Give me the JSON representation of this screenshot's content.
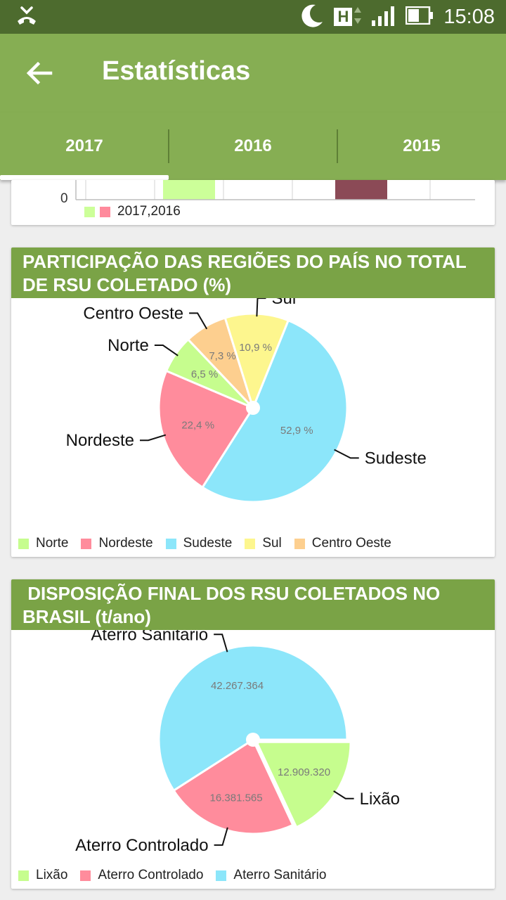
{
  "status_bar": {
    "time": "15:08",
    "network_letter": "H"
  },
  "header": {
    "title": "Estatísticas"
  },
  "tabs": [
    {
      "label": "2017"
    },
    {
      "label": "2016"
    },
    {
      "label": "2015"
    }
  ],
  "active_tab": "2017",
  "top_chart": {
    "y_tick": "0",
    "legend_label": "2017,2016",
    "colors": [
      "#ccff99",
      "#ff8a9c"
    ],
    "bar_colors": [
      "#ccff99",
      "#8b4a56"
    ]
  },
  "chart_data": [
    {
      "type": "pie",
      "title": "PARTICIPAÇÃO DAS REGIÕES DO PAÍS NO TOTAL DE RSU COLETADO (%)",
      "slices": [
        {
          "label": "Sudeste",
          "value": 52.9,
          "value_label": "52,9 %",
          "color": "#8ce6fa"
        },
        {
          "label": "Nordeste",
          "value": 22.4,
          "value_label": "22,4 %",
          "color": "#ff8c9c"
        },
        {
          "label": "Norte",
          "value": 6.5,
          "value_label": "6,5 %",
          "color": "#c6fd8e"
        },
        {
          "label": "Centro Oeste",
          "value": 7.3,
          "value_label": "7,3 %",
          "color": "#fdcf8f"
        },
        {
          "label": "Sul",
          "value": 10.9,
          "value_label": "10,9 %",
          "color": "#fdf68e"
        }
      ],
      "legend": [
        "Norte",
        "Nordeste",
        "Sudeste",
        "Sul",
        "Centro Oeste"
      ],
      "legend_placement": "bottom"
    },
    {
      "type": "pie",
      "title": " DISPOSIÇÃO FINAL DOS RSU COLETADOS NO BRASIL (t/ano)",
      "slices": [
        {
          "label": "Lixão",
          "value": 12909320,
          "value_label": "12.909.320",
          "color": "#c6fd8e"
        },
        {
          "label": "Aterro Controlado",
          "value": 16381565,
          "value_label": "16.381.565",
          "color": "#ff8c9c"
        },
        {
          "label": "Aterro Sanitário",
          "value": 42267364,
          "value_label": "42.267.364",
          "color": "#8ce6fa"
        }
      ],
      "legend": [
        "Lixão",
        "Aterro Controlado",
        "Aterro Sanitário"
      ],
      "legend_placement": "bottom"
    }
  ]
}
